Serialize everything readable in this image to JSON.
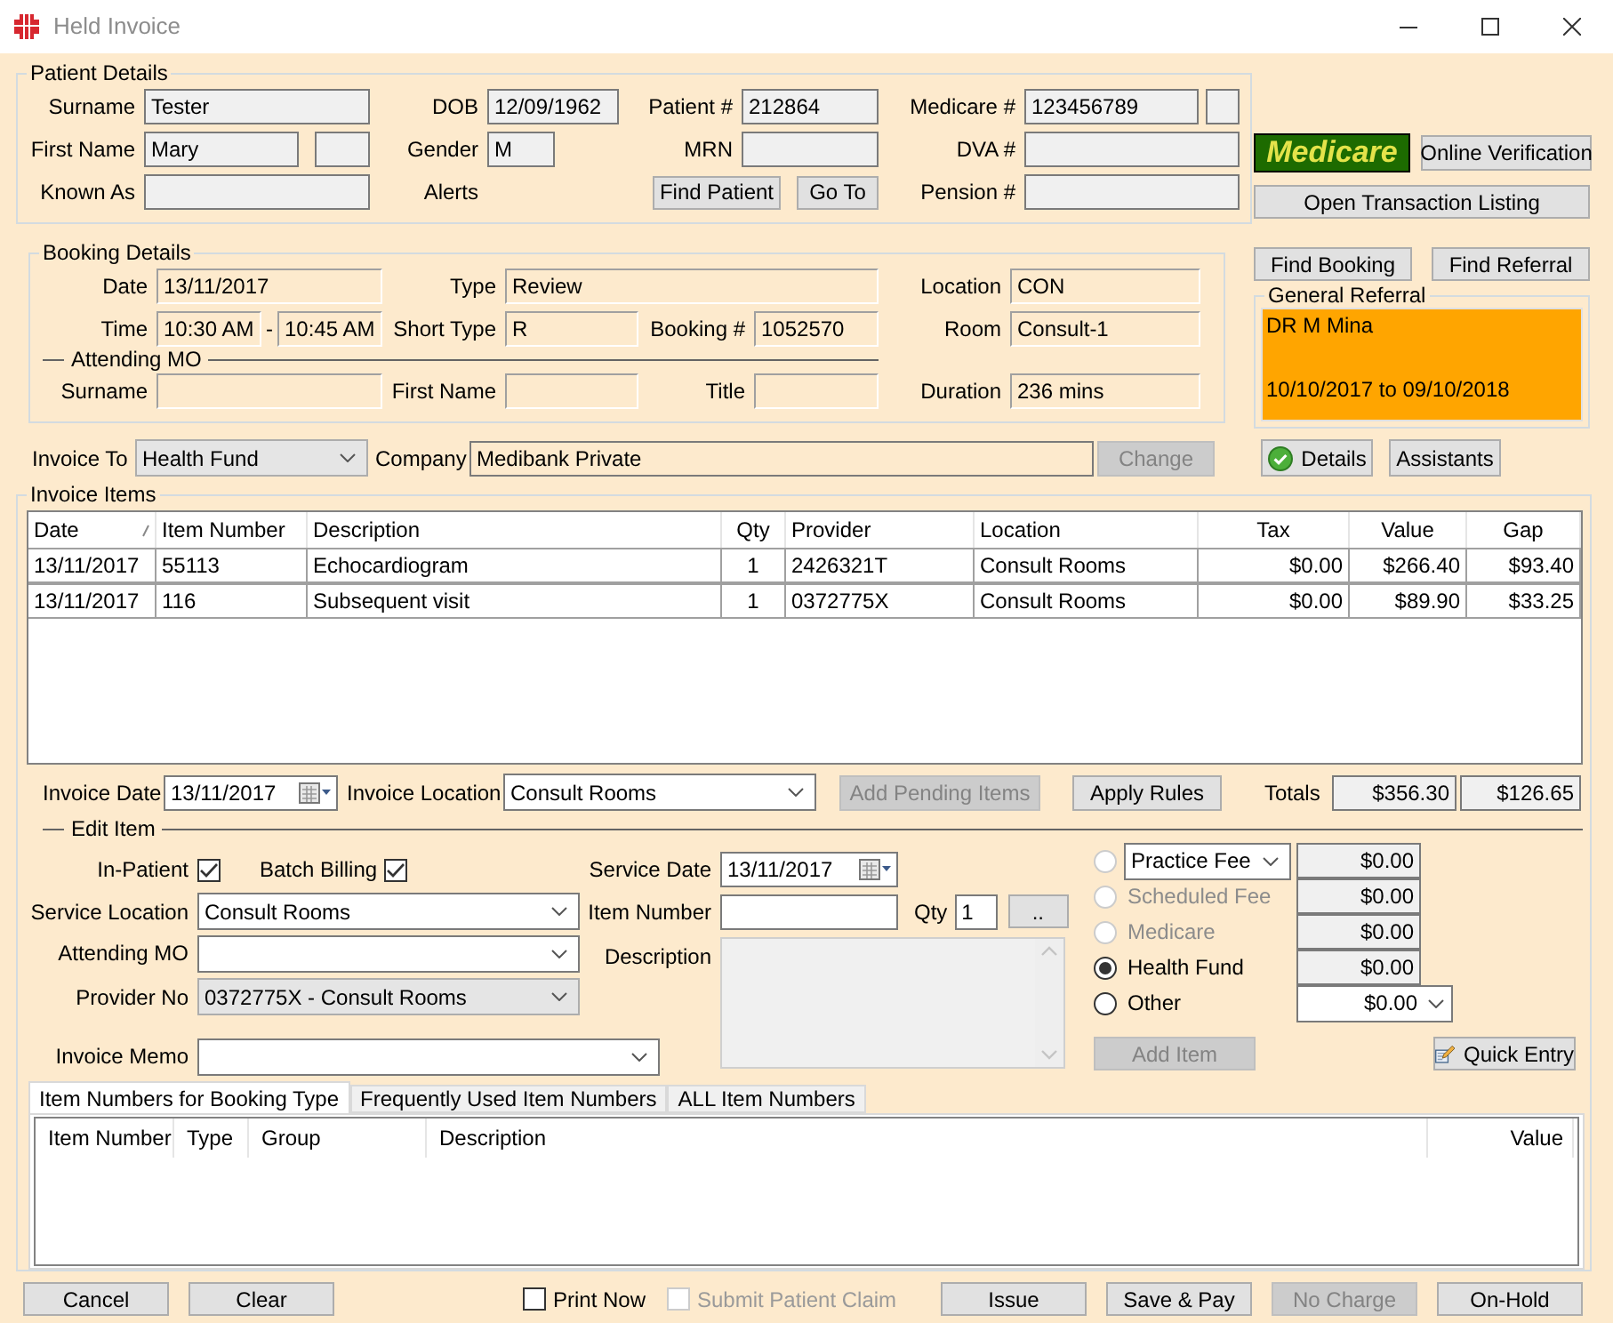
{
  "window": {
    "title": "Held Invoice"
  },
  "patient_details": {
    "title": "Patient Details",
    "surname": {
      "label": "Surname",
      "value": "Tester"
    },
    "first_name": {
      "label": "First Name",
      "value": "Mary"
    },
    "known_as": {
      "label": "Known As"
    },
    "dob": {
      "label": "DOB",
      "value": "12/09/1962"
    },
    "gender": {
      "label": "Gender",
      "value": "M"
    },
    "alerts": {
      "label": "Alerts"
    },
    "patient_no": {
      "label": "Patient #",
      "value": "212864"
    },
    "mrn": {
      "label": "MRN"
    },
    "find_patient_button": "Find Patient",
    "go_to_button": "Go To",
    "medicare_no": {
      "label": "Medicare #",
      "value": "123456789"
    },
    "dva_no": {
      "label": "DVA #"
    },
    "pension_no": {
      "label": "Pension #"
    }
  },
  "medicare_badge": "Medicare",
  "online_verification_button": "Online Verification",
  "open_transaction_listing_button": "Open Transaction Listing",
  "booking_details": {
    "title": "Booking Details",
    "date": {
      "label": "Date",
      "value": "13/11/2017"
    },
    "time": {
      "label": "Time",
      "start": "10:30 AM",
      "separator": "-",
      "end": "10:45 AM"
    },
    "type": {
      "label": "Type",
      "value": "Review"
    },
    "short_type": {
      "label": "Short Type",
      "value": "R"
    },
    "booking_no": {
      "label": "Booking #",
      "value": "1052570"
    },
    "location": {
      "label": "Location",
      "value": "CON"
    },
    "room": {
      "label": "Room",
      "value": "Consult-1"
    },
    "attending_mo": {
      "title": "Attending MO",
      "surname": {
        "label": "Surname"
      },
      "first_name": {
        "label": "First Name"
      },
      "title_field": {
        "label": "Title"
      }
    },
    "duration": {
      "label": "Duration",
      "value": "236 mins"
    }
  },
  "find_booking_button": "Find Booking",
  "find_referral_button": "Find Referral",
  "general_referral": {
    "title": "General Referral",
    "doctor": "DR M Mina",
    "validity": "10/10/2017 to 09/10/2018"
  },
  "invoice_to": {
    "label": "Invoice To",
    "value": "Health Fund"
  },
  "company": {
    "label": "Company",
    "value": "Medibank Private"
  },
  "change_button": {
    "label": "Change",
    "disabled": true
  },
  "details_button": {
    "label": "Details"
  },
  "assistants_button": {
    "label": "Assistants"
  },
  "invoice_items": {
    "title": "Invoice Items",
    "columns": [
      {
        "label": "Date",
        "kind": "text",
        "sorted": true
      },
      {
        "label": "Item Number",
        "kind": "text",
        "sorted": false
      },
      {
        "label": "Description",
        "kind": "text",
        "sorted": false
      },
      {
        "label": "Qty",
        "kind": "count",
        "sorted": false
      },
      {
        "label": "Provider",
        "kind": "text",
        "sorted": false
      },
      {
        "label": "Location",
        "kind": "text",
        "sorted": false
      },
      {
        "label": "Tax",
        "kind": "money",
        "sorted": false
      },
      {
        "label": "Value",
        "kind": "money",
        "sorted": false
      },
      {
        "label": "Gap",
        "kind": "money",
        "sorted": false
      }
    ],
    "rows": [
      [
        "13/11/2017",
        "55113",
        "Echocardiogram",
        "1",
        "2426321T",
        "Consult Rooms",
        "$0.00",
        "$266.40",
        "$93.40"
      ],
      [
        "13/11/2017",
        "116",
        "Subsequent visit",
        "1",
        "0372775X",
        "Consult Rooms",
        "$0.00",
        "$89.90",
        "$33.25"
      ]
    ]
  },
  "invoice_date": {
    "label": "Invoice Date",
    "value": "13/11/2017"
  },
  "invoice_location": {
    "label": "Invoice Location",
    "value": "Consult Rooms"
  },
  "add_pending_items_button": {
    "label": "Add Pending Items",
    "disabled": true
  },
  "apply_rules_button": {
    "label": "Apply Rules",
    "disabled": false
  },
  "totals": {
    "label": "Totals",
    "value": "$356.30",
    "gap": "$126.65"
  },
  "edit_item": {
    "title": "Edit Item",
    "in_patient": {
      "label": "In-Patient",
      "checked": true
    },
    "batch_billing": {
      "label": "Batch Billing",
      "checked": true
    },
    "service_date": {
      "label": "Service Date",
      "value": "13/11/2017"
    },
    "service_location": {
      "label": "Service Location",
      "value": "Consult Rooms"
    },
    "item_number": {
      "label": "Item Number"
    },
    "qty": {
      "label": "Qty",
      "value": "1"
    },
    "browse_button": "..",
    "attending_mo": {
      "label": "Attending MO"
    },
    "description": {
      "label": "Description"
    },
    "provider_no": {
      "label": "Provider No",
      "value": "0372775X - Consult Rooms"
    },
    "invoice_memo": {
      "label": "Invoice Memo"
    },
    "fees": [
      {
        "kind": "dropdown",
        "label": "Practice Fee",
        "selected": false,
        "disabled": true,
        "amount": {
          "kind": "readonly",
          "value": "$0.00"
        }
      },
      {
        "kind": "radio",
        "label": "Scheduled Fee",
        "selected": false,
        "disabled": true,
        "amount": {
          "kind": "readonly",
          "value": "$0.00"
        }
      },
      {
        "kind": "radio",
        "label": "Medicare",
        "selected": false,
        "disabled": true,
        "amount": {
          "kind": "readonly",
          "value": "$0.00"
        }
      },
      {
        "kind": "radio",
        "label": "Health Fund",
        "selected": true,
        "disabled": false,
        "amount": {
          "kind": "readonly",
          "value": "$0.00"
        }
      },
      {
        "kind": "radio",
        "label": "Other",
        "selected": false,
        "disabled": false,
        "amount": {
          "kind": "dropdown",
          "value": "$0.00"
        }
      }
    ],
    "add_item_button": {
      "label": "Add Item",
      "disabled": true
    },
    "quick_entry_button": "Quick Entry"
  },
  "item_tabs": [
    {
      "label": "Item Numbers for Booking Type",
      "selected": true
    },
    {
      "label": "Frequently Used Item Numbers",
      "selected": false
    },
    {
      "label": "ALL Item Numbers",
      "selected": false
    }
  ],
  "item_table": {
    "columns": [
      {
        "label": "Item Number",
        "kind": "text"
      },
      {
        "label": "Type",
        "kind": "text"
      },
      {
        "label": "Group",
        "kind": "text"
      },
      {
        "label": "Description",
        "kind": "text"
      },
      {
        "label": "Value",
        "kind": "money"
      }
    ]
  },
  "footer": [
    {
      "kind": "button",
      "label": "Cancel",
      "disabled": false
    },
    {
      "kind": "button",
      "label": "Clear",
      "disabled": false
    },
    {
      "kind": "checkbox",
      "label": "Print Now",
      "checked": false,
      "disabled": false
    },
    {
      "kind": "checkbox",
      "label": "Submit Patient Claim",
      "checked": false,
      "disabled": true
    },
    {
      "kind": "button",
      "label": "Issue",
      "disabled": false
    },
    {
      "kind": "button",
      "label": "Save & Pay",
      "disabled": false
    },
    {
      "kind": "button",
      "label": "No Charge",
      "disabled": true
    },
    {
      "kind": "button",
      "label": "On-Hold",
      "disabled": false
    }
  ]
}
